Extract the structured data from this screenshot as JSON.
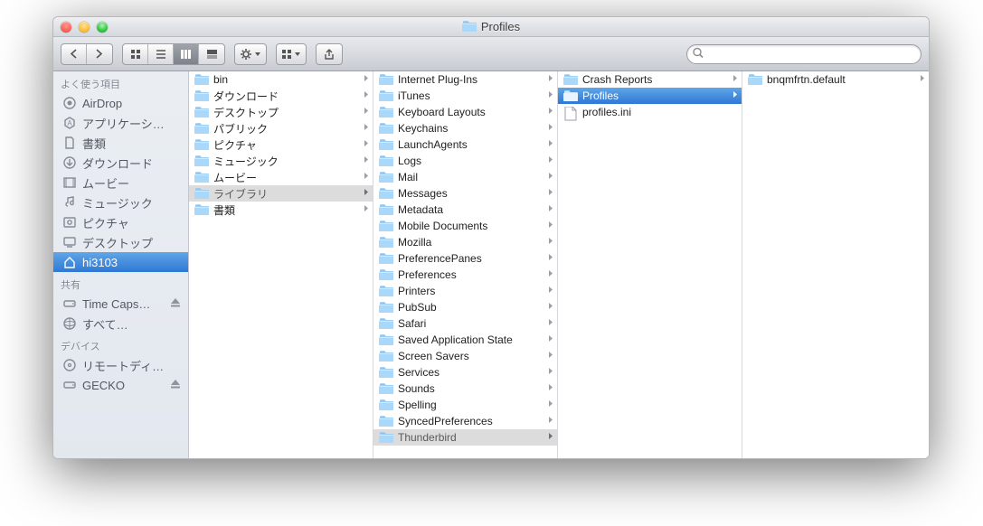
{
  "window": {
    "title": "Profiles"
  },
  "search": {
    "placeholder": ""
  },
  "sidebar": {
    "sections": [
      {
        "title": "よく使う項目",
        "items": [
          {
            "icon": "airdrop",
            "label": "AirDrop"
          },
          {
            "icon": "apps",
            "label": "アプリケーシ…"
          },
          {
            "icon": "doc",
            "label": "書類"
          },
          {
            "icon": "download",
            "label": "ダウンロード"
          },
          {
            "icon": "movie",
            "label": "ムービー"
          },
          {
            "icon": "music",
            "label": "ミュージック"
          },
          {
            "icon": "pictures",
            "label": "ピクチャ"
          },
          {
            "icon": "desktop",
            "label": "デスクトップ"
          },
          {
            "icon": "home",
            "label": "hi3103",
            "selected": true
          }
        ]
      },
      {
        "title": "共有",
        "items": [
          {
            "icon": "drive",
            "label": "Time Caps…",
            "eject": true
          },
          {
            "icon": "network",
            "label": "すべて…"
          }
        ]
      },
      {
        "title": "デバイス",
        "items": [
          {
            "icon": "disc",
            "label": "リモートディ…"
          },
          {
            "icon": "drive",
            "label": "GECKO",
            "eject": true
          }
        ]
      }
    ]
  },
  "columns": [
    {
      "items": [
        {
          "name": "bin",
          "type": "folder",
          "hasChildren": true
        },
        {
          "name": "ダウンロード",
          "type": "folder",
          "hasChildren": true
        },
        {
          "name": "デスクトップ",
          "type": "folder",
          "hasChildren": true
        },
        {
          "name": "パブリック",
          "type": "folder",
          "hasChildren": true
        },
        {
          "name": "ピクチャ",
          "type": "folder",
          "hasChildren": true
        },
        {
          "name": "ミュージック",
          "type": "folder",
          "hasChildren": true
        },
        {
          "name": "ムービー",
          "type": "folder",
          "hasChildren": true
        },
        {
          "name": "ライブラリ",
          "type": "folder",
          "hasChildren": true,
          "selected": "inactive"
        },
        {
          "name": "書類",
          "type": "folder",
          "hasChildren": true
        }
      ]
    },
    {
      "items": [
        {
          "name": "Internet Plug-Ins",
          "type": "folder",
          "hasChildren": true
        },
        {
          "name": "iTunes",
          "type": "folder",
          "hasChildren": true
        },
        {
          "name": "Keyboard Layouts",
          "type": "folder",
          "hasChildren": true
        },
        {
          "name": "Keychains",
          "type": "folder",
          "hasChildren": true
        },
        {
          "name": "LaunchAgents",
          "type": "folder",
          "hasChildren": true
        },
        {
          "name": "Logs",
          "type": "folder",
          "hasChildren": true
        },
        {
          "name": "Mail",
          "type": "folder",
          "hasChildren": true
        },
        {
          "name": "Messages",
          "type": "folder",
          "hasChildren": true
        },
        {
          "name": "Metadata",
          "type": "folder",
          "hasChildren": true
        },
        {
          "name": "Mobile Documents",
          "type": "folder",
          "hasChildren": true
        },
        {
          "name": "Mozilla",
          "type": "folder",
          "hasChildren": true
        },
        {
          "name": "PreferencePanes",
          "type": "folder",
          "hasChildren": true
        },
        {
          "name": "Preferences",
          "type": "folder",
          "hasChildren": true
        },
        {
          "name": "Printers",
          "type": "folder",
          "hasChildren": true
        },
        {
          "name": "PubSub",
          "type": "folder",
          "hasChildren": true
        },
        {
          "name": "Safari",
          "type": "folder",
          "hasChildren": true
        },
        {
          "name": "Saved Application State",
          "type": "folder",
          "hasChildren": true
        },
        {
          "name": "Screen Savers",
          "type": "folder",
          "hasChildren": true
        },
        {
          "name": "Services",
          "type": "folder",
          "hasChildren": true
        },
        {
          "name": "Sounds",
          "type": "folder",
          "hasChildren": true
        },
        {
          "name": "Spelling",
          "type": "folder",
          "hasChildren": true
        },
        {
          "name": "SyncedPreferences",
          "type": "folder",
          "hasChildren": true
        },
        {
          "name": "Thunderbird",
          "type": "folder",
          "hasChildren": true,
          "selected": "inactive"
        }
      ]
    },
    {
      "items": [
        {
          "name": "Crash Reports",
          "type": "folder",
          "hasChildren": true
        },
        {
          "name": "Profiles",
          "type": "folder",
          "hasChildren": true,
          "selected": "active"
        },
        {
          "name": "profiles.ini",
          "type": "file"
        }
      ]
    },
    {
      "items": [
        {
          "name": "bnqmfrtn.default",
          "type": "folder",
          "hasChildren": true
        }
      ]
    }
  ]
}
